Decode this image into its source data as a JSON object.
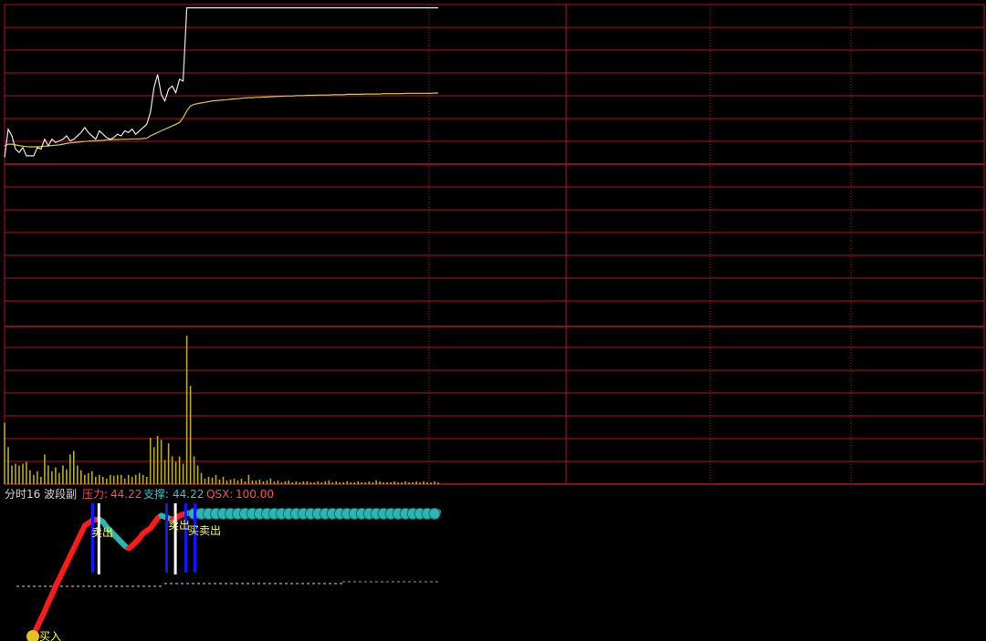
{
  "colors": {
    "background": "#000000",
    "grid": "#b4141e",
    "price_line": "#e8e8e8",
    "avg_line": "#d8c832",
    "volume_bar": "#b8aa28",
    "band_rise": "#ff1a1a",
    "band_fall": "#2bb6b6",
    "signal_line": "#1414ff",
    "signal_text": "#ffff33",
    "label_white": "#d8d8d8",
    "label_pressure": "#ff5050",
    "label_support": "#36c6c6",
    "label_qsx": "#ff5050",
    "dotted_white": "#d8d8d8",
    "dotted_cyan": "#36c6c6"
  },
  "indicator_header": {
    "name": "分时16 波段副",
    "pressure_label": "压力:",
    "pressure_value": "44.22",
    "support_label": "支撑:",
    "support_value": "44.22",
    "qsx_label": "QSX:",
    "qsx_value": "100.00"
  },
  "signals": {
    "buy_label": "买入",
    "sell_label": "卖出",
    "buy_sell_label": "买卖出"
  },
  "chart_data": [
    {
      "type": "line",
      "panel": "price",
      "x": [
        0,
        1,
        2,
        3,
        4,
        5,
        6,
        7,
        8,
        9,
        10,
        11,
        12,
        13,
        14,
        15,
        16,
        17,
        18,
        19,
        20,
        21,
        22,
        23,
        24,
        25,
        26,
        27,
        28,
        29,
        30,
        31,
        32,
        33,
        34,
        35,
        36,
        37,
        38,
        39,
        40,
        41,
        42,
        43,
        44,
        45,
        46,
        47,
        48,
        49,
        50,
        51,
        52,
        53,
        54,
        55,
        56,
        57,
        58,
        59,
        60,
        61,
        62,
        63,
        64,
        65,
        66,
        67,
        68,
        69,
        70,
        71,
        72,
        73,
        74,
        75,
        76,
        77,
        78,
        79,
        80,
        81,
        82,
        83,
        84,
        85,
        86,
        87,
        88,
        89,
        90,
        91,
        92,
        93,
        94,
        95,
        96,
        97,
        98,
        99,
        100,
        101,
        102,
        103,
        104,
        105,
        106,
        107,
        108,
        109,
        110,
        111,
        112,
        113,
        114,
        115,
        116,
        117,
        118,
        119
      ],
      "series": [
        {
          "values": [
            2.0,
            10.5,
            8.5,
            4.5,
            3.5,
            5.0,
            2.5,
            2.5,
            2.5,
            5.0,
            4.5,
            7.5,
            5.5,
            7.5,
            6.5,
            7.0,
            7.5,
            8.5,
            7.0,
            7.5,
            8.5,
            9.5,
            11.0,
            9.5,
            8.5,
            7.5,
            10.0,
            9.0,
            8.0,
            7.5,
            8.0,
            9.0,
            8.5,
            10.0,
            9.5,
            10.5,
            9.0,
            10.0,
            11.0,
            12.0,
            15.5,
            23.0,
            27.0,
            21.0,
            19.0,
            22.5,
            23.5,
            21.5,
            25.5,
            25.0,
            47.0,
            47.0,
            47.0,
            47.0,
            47.0,
            47.0,
            47.0,
            47.0,
            47.0,
            47.0,
            47.0,
            47.0,
            47.0,
            47.0,
            47.0,
            47.0,
            47.0,
            47.0,
            47.0,
            47.0,
            47.0,
            47.0,
            47.0,
            47.0,
            47.0,
            47.0,
            47.0,
            47.0,
            47.0,
            47.0,
            47.0,
            47.0,
            47.0,
            47.0,
            47.0,
            47.0,
            47.0,
            47.0,
            47.0,
            47.0,
            47.0,
            47.0,
            47.0,
            47.0,
            47.0,
            47.0,
            47.0,
            47.0,
            47.0,
            47.0,
            47.0,
            47.0,
            47.0,
            47.0,
            47.0,
            47.0,
            47.0,
            47.0,
            47.0,
            47.0,
            47.0,
            47.0,
            47.0,
            47.0,
            47.0,
            47.0,
            47.0,
            47.0,
            47.0,
            47.0
          ]
        },
        {
          "values": [
            5.5,
            6.0,
            6.0,
            5.8,
            5.6,
            5.4,
            5.3,
            5.2,
            5.2,
            5.2,
            5.3,
            5.4,
            5.5,
            5.6,
            5.7,
            5.8,
            6.0,
            6.2,
            6.4,
            6.5,
            6.6,
            6.7,
            6.8,
            6.9,
            7.0,
            7.0,
            7.1,
            7.2,
            7.3,
            7.3,
            7.4,
            7.4,
            7.5,
            7.5,
            7.5,
            7.6,
            7.6,
            7.6,
            7.7,
            7.8,
            8.5,
            9.0,
            9.5,
            10.0,
            10.5,
            11.0,
            11.5,
            12.0,
            12.5,
            14.0,
            16.0,
            17.5,
            18.0,
            18.2,
            18.4,
            18.6,
            18.8,
            19.0,
            19.1,
            19.2,
            19.3,
            19.4,
            19.5,
            19.6,
            19.7,
            19.8,
            19.9,
            20.0,
            20.0,
            20.1,
            20.1,
            20.2,
            20.2,
            20.3,
            20.3,
            20.4,
            20.4,
            20.5,
            20.5,
            20.5,
            20.6,
            20.6,
            20.6,
            20.7,
            20.7,
            20.7,
            20.8,
            20.8,
            20.8,
            20.8,
            20.9,
            20.9,
            20.9,
            20.9,
            21.0,
            21.0,
            21.0,
            21.0,
            21.0,
            21.1,
            21.1,
            21.1,
            21.1,
            21.1,
            21.2,
            21.2,
            21.2,
            21.2,
            21.2,
            21.2,
            21.3,
            21.3,
            21.3,
            21.3,
            21.3,
            21.3,
            21.3,
            21.3,
            21.4,
            21.4
          ]
        }
      ],
      "ylim": [
        0,
        48
      ]
    },
    {
      "type": "bar",
      "panel": "volume",
      "categories": [
        0,
        1,
        2,
        3,
        4,
        5,
        6,
        7,
        8,
        9,
        10,
        11,
        12,
        13,
        14,
        15,
        16,
        17,
        18,
        19,
        20,
        21,
        22,
        23,
        24,
        25,
        26,
        27,
        28,
        29,
        30,
        31,
        32,
        33,
        34,
        35,
        36,
        37,
        38,
        39,
        40,
        41,
        42,
        43,
        44,
        45,
        46,
        47,
        48,
        49,
        50,
        51,
        52,
        53,
        54,
        55,
        56,
        57,
        58,
        59,
        60,
        61,
        62,
        63,
        64,
        65,
        66,
        67,
        68,
        69,
        70,
        71,
        72,
        73,
        74,
        75,
        76,
        77,
        78,
        79,
        80,
        81,
        82,
        83,
        84,
        85,
        86,
        87,
        88,
        89,
        90,
        91,
        92,
        93,
        94,
        95,
        96,
        97,
        98,
        99,
        100,
        101,
        102,
        103,
        104,
        105,
        106,
        107,
        108,
        109,
        110,
        111,
        112,
        113,
        114,
        115,
        116,
        117,
        118,
        119
      ],
      "values": [
        66,
        40,
        20,
        22,
        20,
        22,
        24,
        15,
        10,
        14,
        8,
        32,
        20,
        14,
        18,
        12,
        20,
        16,
        32,
        36,
        20,
        15,
        10,
        12,
        14,
        8,
        10,
        8,
        6,
        10,
        9,
        10,
        10,
        6,
        10,
        8,
        10,
        12,
        10,
        8,
        50,
        40,
        52,
        48,
        26,
        44,
        30,
        24,
        30,
        22,
        160,
        106,
        30,
        20,
        12,
        6,
        8,
        7,
        10,
        5,
        8,
        4,
        5,
        6,
        4,
        6,
        3,
        10,
        4,
        4,
        5,
        3,
        4,
        6,
        3,
        4,
        2,
        3,
        4,
        2,
        3,
        2,
        3,
        3,
        2,
        2,
        3,
        2,
        3,
        4,
        2,
        3,
        2,
        2,
        3,
        2,
        2,
        3,
        2,
        2,
        3,
        2,
        4,
        3,
        2,
        2,
        2,
        3,
        2,
        2,
        3,
        2,
        2,
        3,
        2,
        3,
        2,
        2,
        3,
        2
      ],
      "ylim": [
        0,
        170
      ]
    },
    {
      "type": "area",
      "panel": "indicator",
      "x": [
        0,
        1,
        2,
        3,
        4,
        5,
        6,
        7,
        8,
        9,
        10,
        11,
        12,
        13,
        14,
        15,
        16,
        17,
        18,
        19,
        20,
        21,
        22,
        23,
        24,
        25,
        26,
        27,
        28,
        29,
        30,
        31,
        32,
        33,
        34,
        35,
        36,
        37,
        38,
        39,
        40,
        41,
        42,
        43,
        44,
        45,
        46,
        47,
        48,
        49,
        50,
        51,
        52,
        53,
        54,
        55,
        56,
        57,
        58,
        59,
        60,
        61,
        62,
        63,
        64,
        65,
        66,
        67,
        68,
        69,
        70,
        71,
        72,
        73,
        74,
        75,
        76,
        77,
        78,
        79,
        80,
        81,
        82,
        83,
        84,
        85,
        86,
        87,
        88,
        89,
        90,
        91,
        92,
        93,
        94,
        95,
        96,
        97,
        98,
        99,
        100,
        101,
        102,
        103,
        104,
        105,
        106,
        107,
        108,
        109,
        110,
        111,
        112,
        113,
        114,
        115,
        116,
        117,
        118,
        119
      ],
      "series": [
        {
          "name": "QSX",
          "values": [
            0,
            0,
            0,
            0,
            0,
            0,
            0,
            0,
            2,
            8,
            14,
            20,
            27,
            33,
            40,
            46,
            52,
            58,
            64,
            70,
            76,
            82,
            88,
            90,
            92,
            93,
            93,
            91,
            87,
            84,
            81,
            78,
            75,
            72,
            70,
            72,
            75,
            78,
            82,
            84,
            86,
            90,
            94,
            96,
            95,
            94,
            93,
            94,
            96,
            97,
            98,
            98,
            99,
            99,
            99,
            99,
            99,
            99,
            99,
            99,
            99,
            99,
            99,
            99,
            99,
            99,
            99,
            99,
            99,
            99,
            99,
            99,
            99,
            99,
            99,
            99,
            99,
            99,
            99,
            99,
            99,
            99,
            99,
            99,
            99,
            99,
            99,
            99,
            99,
            99,
            99,
            99,
            99,
            99,
            99,
            99,
            99,
            99,
            99,
            99,
            99,
            99,
            99,
            99,
            99,
            99,
            99,
            99,
            99,
            99,
            99,
            99,
            99,
            99,
            99,
            99,
            99,
            99,
            99,
            99
          ]
        }
      ],
      "ylim": [
        0,
        100
      ]
    }
  ]
}
